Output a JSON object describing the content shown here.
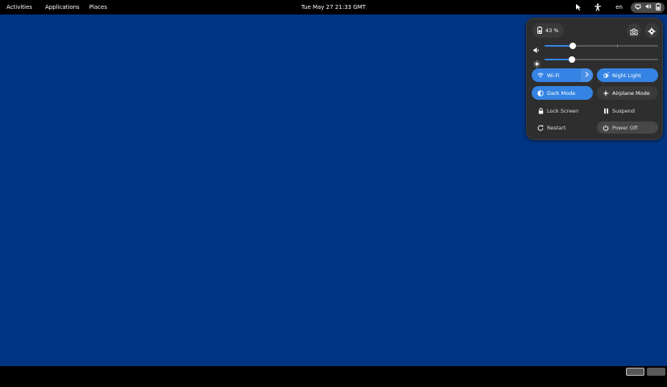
{
  "topbar": {
    "activities": "Activities",
    "applications": "Applications",
    "places": "Places",
    "clock": "Tue May 27  21:33 GMT",
    "language": "en",
    "icons": [
      "pointer-location-icon",
      "accessibility-icon",
      "network-icon",
      "volume-icon",
      "battery-icon"
    ]
  },
  "quick_settings": {
    "battery_percent": "43 %",
    "volume_level": 0.25,
    "brightness_level": 0.24,
    "toggles": {
      "wifi": "Wi-Fi",
      "night_light": "Night Light",
      "dark_mode": "Dark Mode",
      "airplane_mode": "Airplane Mode"
    },
    "actions": {
      "lock_screen": "Lock Screen",
      "suspend": "Suspend",
      "restart": "Restart",
      "power_off": "Power Off"
    }
  },
  "workspaces": {
    "count": 2,
    "active_index": 0
  },
  "colors": {
    "desktop": "#003583",
    "accent": "#3584e4",
    "panel": "#2e2e2e"
  }
}
